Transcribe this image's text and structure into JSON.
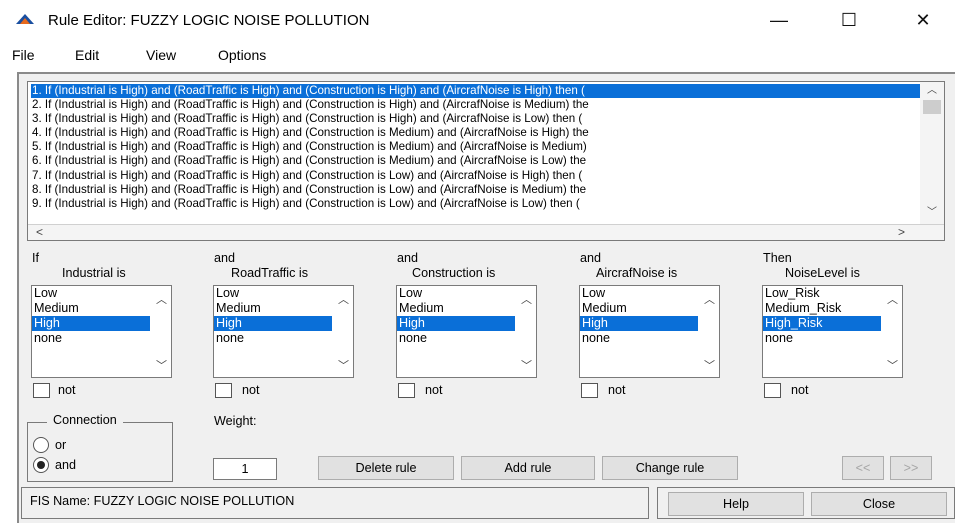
{
  "window": {
    "title": "Rule Editor: FUZZY LOGIC NOISE POLLUTION",
    "minimize_glyph": "—",
    "maximize_glyph": "☐",
    "close_glyph": "✕",
    "app_icon": "matlab-icon"
  },
  "menu": [
    "File",
    "Edit",
    "View",
    "Options"
  ],
  "rules": [
    "1. If (Industrial is High) and (RoadTraffic is High) and (Construction is High) and (AircrafNoise is High) then (",
    "2. If (Industrial is High) and (RoadTraffic is High) and (Construction is High) and (AircrafNoise is Medium) the",
    "3. If (Industrial is High) and (RoadTraffic is High) and (Construction is High) and (AircrafNoise is Low) then (",
    "4. If (Industrial is High) and (RoadTraffic is High) and (Construction is Medium) and (AircrafNoise is High) the",
    "5. If (Industrial is High) and (RoadTraffic is High) and (Construction is Medium) and (AircrafNoise is Medium)",
    "6. If (Industrial is High) and (RoadTraffic is High) and (Construction is Medium) and (AircrafNoise is Low) the",
    "7. If (Industrial is High) and (RoadTraffic is High) and (Construction is Low) and (AircrafNoise is High) then (",
    "8. If (Industrial is High) and (RoadTraffic is High) and (Construction is Low) and (AircrafNoise is Medium) the",
    "9. If (Industrial is High) and (RoadTraffic is High) and (Construction is Low) and (AircrafNoise is Low) then ("
  ],
  "selected_rule_index": 0,
  "columns": [
    {
      "prefix": "If",
      "label": "Industrial is",
      "options": [
        "Low",
        "Medium",
        "High",
        "none"
      ],
      "selected": "High",
      "not_label": "not",
      "not_checked": false
    },
    {
      "prefix": "and",
      "label": "RoadTraffic is",
      "options": [
        "Low",
        "Medium",
        "High",
        "none"
      ],
      "selected": "High",
      "not_label": "not",
      "not_checked": false
    },
    {
      "prefix": "and",
      "label": "Construction is",
      "options": [
        "Low",
        "Medium",
        "High",
        "none"
      ],
      "selected": "High",
      "not_label": "not",
      "not_checked": false
    },
    {
      "prefix": "and",
      "label": "AircrafNoise is",
      "options": [
        "Low",
        "Medium",
        "High",
        "none"
      ],
      "selected": "High",
      "not_label": "not",
      "not_checked": false
    },
    {
      "prefix": "Then",
      "label": "NoiseLevel is",
      "options": [
        "Low_Risk",
        "Medium_Risk",
        "High_Risk",
        "none"
      ],
      "selected": "High_Risk",
      "not_label": "not",
      "not_checked": false
    }
  ],
  "connection": {
    "legend": "Connection",
    "options": [
      "or",
      "and"
    ],
    "selected": "and"
  },
  "weight": {
    "label": "Weight:",
    "value": "1"
  },
  "buttons": {
    "delete_rule": "Delete rule",
    "add_rule": "Add rule",
    "change_rule": "Change rule",
    "prev": "<<",
    "next": ">>",
    "help": "Help",
    "close": "Close"
  },
  "status": {
    "fis_name": "FIS Name: FUZZY LOGIC NOISE POLLUTION"
  },
  "colors": {
    "selection": "#0a6fd8",
    "panel_bg": "#f0f0f0"
  }
}
